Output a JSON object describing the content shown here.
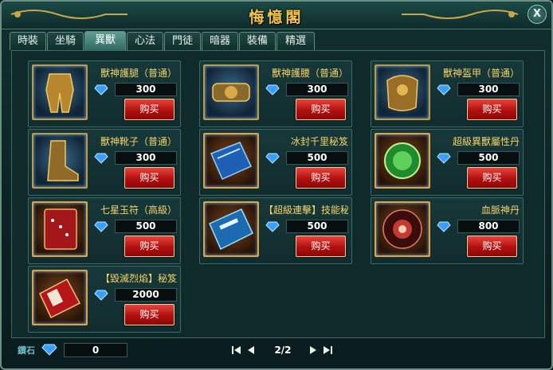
{
  "window": {
    "title": "悔憶閣",
    "close_label": "X"
  },
  "tabs": [
    {
      "label": "時裝",
      "active": false
    },
    {
      "label": "坐騎",
      "active": false
    },
    {
      "label": "異獸",
      "active": true
    },
    {
      "label": "心法",
      "active": false
    },
    {
      "label": "門徒",
      "active": false
    },
    {
      "label": "暗器",
      "active": false
    },
    {
      "label": "裝備",
      "active": false
    },
    {
      "label": "精選",
      "active": false
    }
  ],
  "items": [
    {
      "name": "獸神護腿（普通）",
      "price": "300",
      "buy_label": "购买",
      "icon": "beast-armor-legs-icon",
      "frame": "blue"
    },
    {
      "name": "獸神護腰（普通）",
      "price": "300",
      "buy_label": "购买",
      "icon": "beast-armor-belt-icon",
      "frame": "blue"
    },
    {
      "name": "獸神盔甲（普通）",
      "price": "300",
      "buy_label": "购买",
      "icon": "beast-armor-chest-icon",
      "frame": "blue"
    },
    {
      "name": "獸神靴子（普通）",
      "price": "300",
      "buy_label": "购买",
      "icon": "beast-armor-boots-icon",
      "frame": "blue"
    },
    {
      "name": "冰封千里秘笈",
      "price": "500",
      "buy_label": "购买",
      "icon": "blue-manual-icon",
      "frame": "gold"
    },
    {
      "name": "超級異獸屬性丹",
      "price": "500",
      "buy_label": "购买",
      "icon": "green-beast-pill-icon",
      "frame": "gold"
    },
    {
      "name": "七星玉符（高級）",
      "price": "500",
      "buy_label": "购买",
      "icon": "red-jade-talisman-icon",
      "frame": "gold"
    },
    {
      "name": "【超級連擊】技能秘笈",
      "price": "500",
      "buy_label": "购买",
      "icon": "blue-skill-book-icon",
      "frame": "gold"
    },
    {
      "name": "血脈神丹",
      "price": "800",
      "buy_label": "购买",
      "icon": "blood-pill-icon",
      "frame": "gold"
    },
    {
      "name": "【毀滅烈焰】秘笈",
      "price": "2000",
      "buy_label": "购买",
      "icon": "red-flame-book-icon",
      "frame": "gold"
    }
  ],
  "footer": {
    "currency_label": "鑽石",
    "balance": "0",
    "page": "2/2"
  },
  "colors": {
    "accent": "#f3d36a",
    "buy_button": "#c01512",
    "title": "#f2c34a"
  }
}
